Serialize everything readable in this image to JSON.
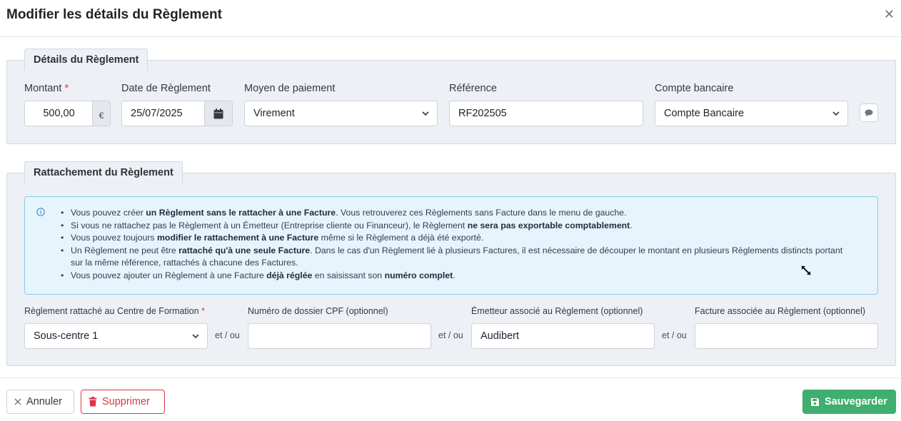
{
  "modal": {
    "title": "Modifier les détails du Règlement",
    "close_icon": "close-icon"
  },
  "details": {
    "legend": "Détails du Règlement",
    "montant": {
      "label": "Montant",
      "required_mark": "*",
      "value": "500,00",
      "currency": "€"
    },
    "date": {
      "label": "Date de Règlement",
      "value": "25/07/2025",
      "icon": "calendar-icon"
    },
    "moyen": {
      "label": "Moyen de paiement",
      "value": "Virement"
    },
    "reference": {
      "label": "Référence",
      "value": "RF202505"
    },
    "compte": {
      "label": "Compte bancaire",
      "value": "Compte Bancaire"
    },
    "comment_icon": "comment-icon"
  },
  "rattachement": {
    "legend": "Rattachement du Règlement",
    "info": [
      {
        "parts": [
          "Vous pouvez créer ",
          "un Règlement sans le rattacher à une Facture",
          ". Vous retrouverez ces Règlements sans Facture dans le menu de gauche."
        ]
      },
      {
        "parts": [
          "Si vous ne rattachez pas le Règlement à un Émetteur (Entreprise cliente ou Financeur), le Règlement ",
          "ne sera pas exportable comptablement",
          "."
        ]
      },
      {
        "parts": [
          "Vous pouvez toujours ",
          "modifier le rattachement à une Facture",
          " même si le Règlement a déjà été exporté."
        ]
      },
      {
        "parts": [
          "Un Règlement ne peut être ",
          "rattaché qu'à une seule Facture",
          ". Dans le cas d'un Règlement lié à plusieurs Factures, il est nécessaire de découper le montant en plusieurs Règlements distincts portant sur la même référence, rattachés à chacune des Factures."
        ]
      },
      {
        "parts": [
          "Vous pouvez ajouter un Règlement à une Facture ",
          "déjà réglée",
          " en saisissant son ",
          "numéro complet",
          "."
        ]
      }
    ],
    "centre": {
      "label": "Règlement rattaché au Centre de Formation",
      "required_mark": "*",
      "value": "Sous-centre 1"
    },
    "cpf": {
      "label": "Numéro de dossier CPF (optionnel)",
      "value": ""
    },
    "emetteur": {
      "label": "Émetteur associé au Règlement (optionnel)",
      "value": "Audibert"
    },
    "facture": {
      "label": "Facture associée au Règlement (optionnel)",
      "value": ""
    },
    "et_ou": "et / ou"
  },
  "footer": {
    "cancel_label": "Annuler",
    "delete_label": "Supprimer",
    "save_label": "Sauvegarder"
  },
  "colors": {
    "save": "#3fae6e",
    "delete": "#dc3545",
    "info_bg": "#e6f4fb",
    "info_border": "#8ccbe6",
    "fieldset_bg": "#edf0f5"
  }
}
